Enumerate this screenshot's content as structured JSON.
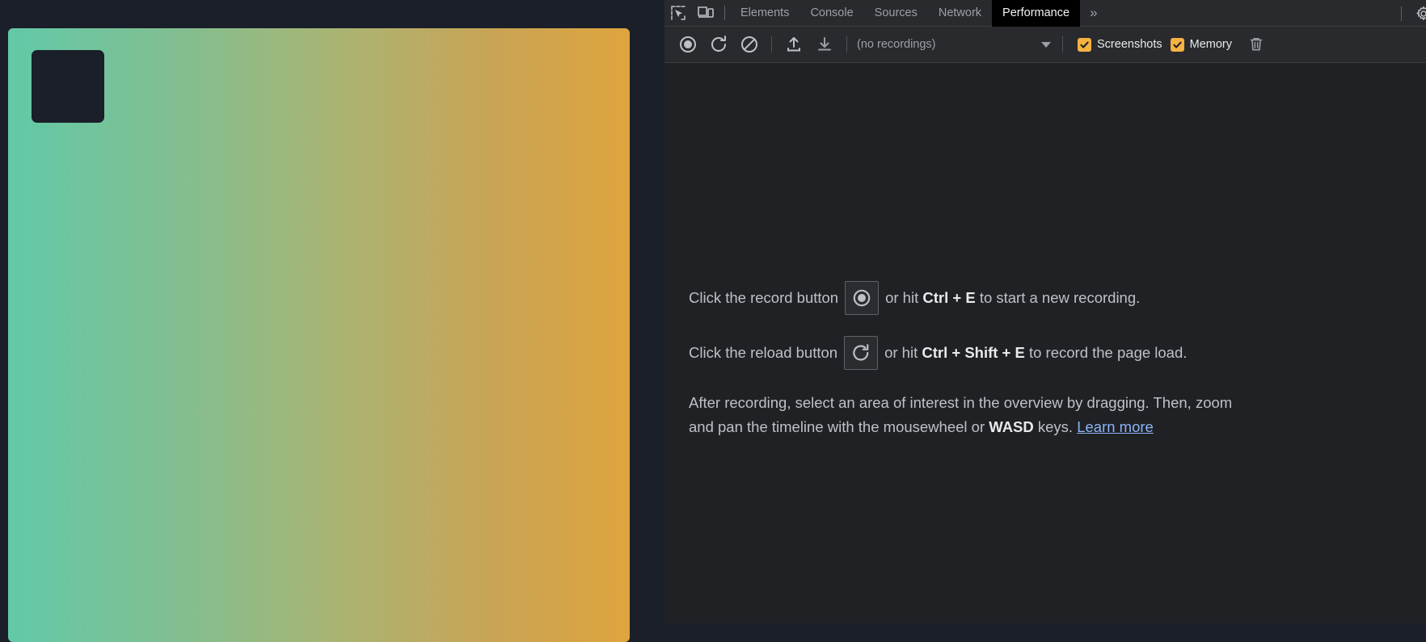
{
  "page": {
    "gradient": {
      "from": "#62c9a7",
      "to": "#dfa43d",
      "card_color": "#1b1f2a"
    }
  },
  "devtools": {
    "tabbar": {
      "inspect_icon": "inspect-element-icon",
      "device_icon": "device-toolbar-icon",
      "tabs": [
        {
          "label": "Elements",
          "active": false
        },
        {
          "label": "Console",
          "active": false
        },
        {
          "label": "Sources",
          "active": false
        },
        {
          "label": "Network",
          "active": false
        },
        {
          "label": "Performance",
          "active": true
        }
      ],
      "more_tabs_label": "»",
      "settings_icon": "gear-icon"
    },
    "toolbar": {
      "record_icon": "record-icon",
      "reload_record_icon": "reload-record-icon",
      "clear_icon": "clear-icon",
      "load_profile_icon": "upload-icon",
      "save_profile_icon": "download-icon",
      "recordings_value": "(no recordings)",
      "caret_icon": "chevron-down-icon",
      "checkboxes": [
        {
          "label": "Screenshots",
          "checked": true
        },
        {
          "label": "Memory",
          "checked": true
        }
      ],
      "trash_icon": "trash-icon",
      "accent_color": "#f5b142"
    },
    "landing": {
      "line1_before": "Click the record button",
      "line1_after_prefix": "or hit",
      "line1_kbd": "Ctrl + E",
      "line1_after_suffix": "to start a new recording.",
      "line2_before": "Click the reload button",
      "line2_after_prefix": "or hit",
      "line2_kbd": "Ctrl + Shift + E",
      "line2_after_suffix": "to record the page load.",
      "paragraph_part1": "After recording, select an area of interest in the overview by dragging. Then, zoom and pan the timeline with the mousewheel or",
      "paragraph_kbd": "WASD",
      "paragraph_part2": "keys.",
      "learn_more": "Learn more",
      "link_color": "#8ab4f8"
    }
  }
}
